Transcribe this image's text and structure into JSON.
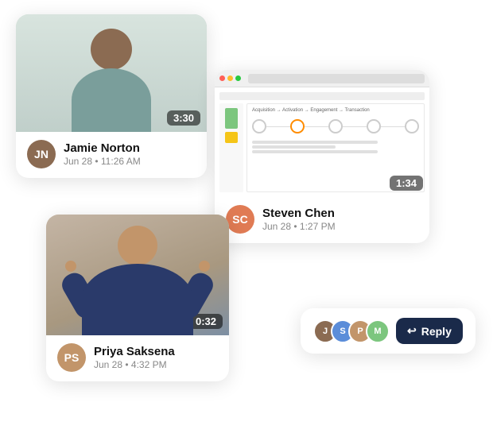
{
  "cards": {
    "jamie": {
      "name": "Jamie Norton",
      "date": "Jun 28 • 11:26 AM",
      "duration": "3:30",
      "avatar_color": "#8B6B52",
      "avatar_initials": "JN"
    },
    "steven": {
      "name": "Steven Chen",
      "date": "Jun 28 • 1:27 PM",
      "duration": "1:34",
      "avatar_color": "#e07b54",
      "avatar_initials": "SC"
    },
    "priya": {
      "name": "Priya Saksena",
      "date": "Jun 28 • 4:32 PM",
      "duration": "0:32",
      "avatar_color": "#c2956a",
      "avatar_initials": "PS"
    }
  },
  "reply_card": {
    "button_label": "Reply",
    "reply_icon": "↩",
    "avatars": [
      {
        "initials": "J",
        "color": "#8B6B52"
      },
      {
        "initials": "S",
        "color": "#5b8dd9"
      },
      {
        "initials": "P",
        "color": "#c2956a"
      },
      {
        "initials": "M",
        "color": "#7cc67e"
      }
    ]
  }
}
